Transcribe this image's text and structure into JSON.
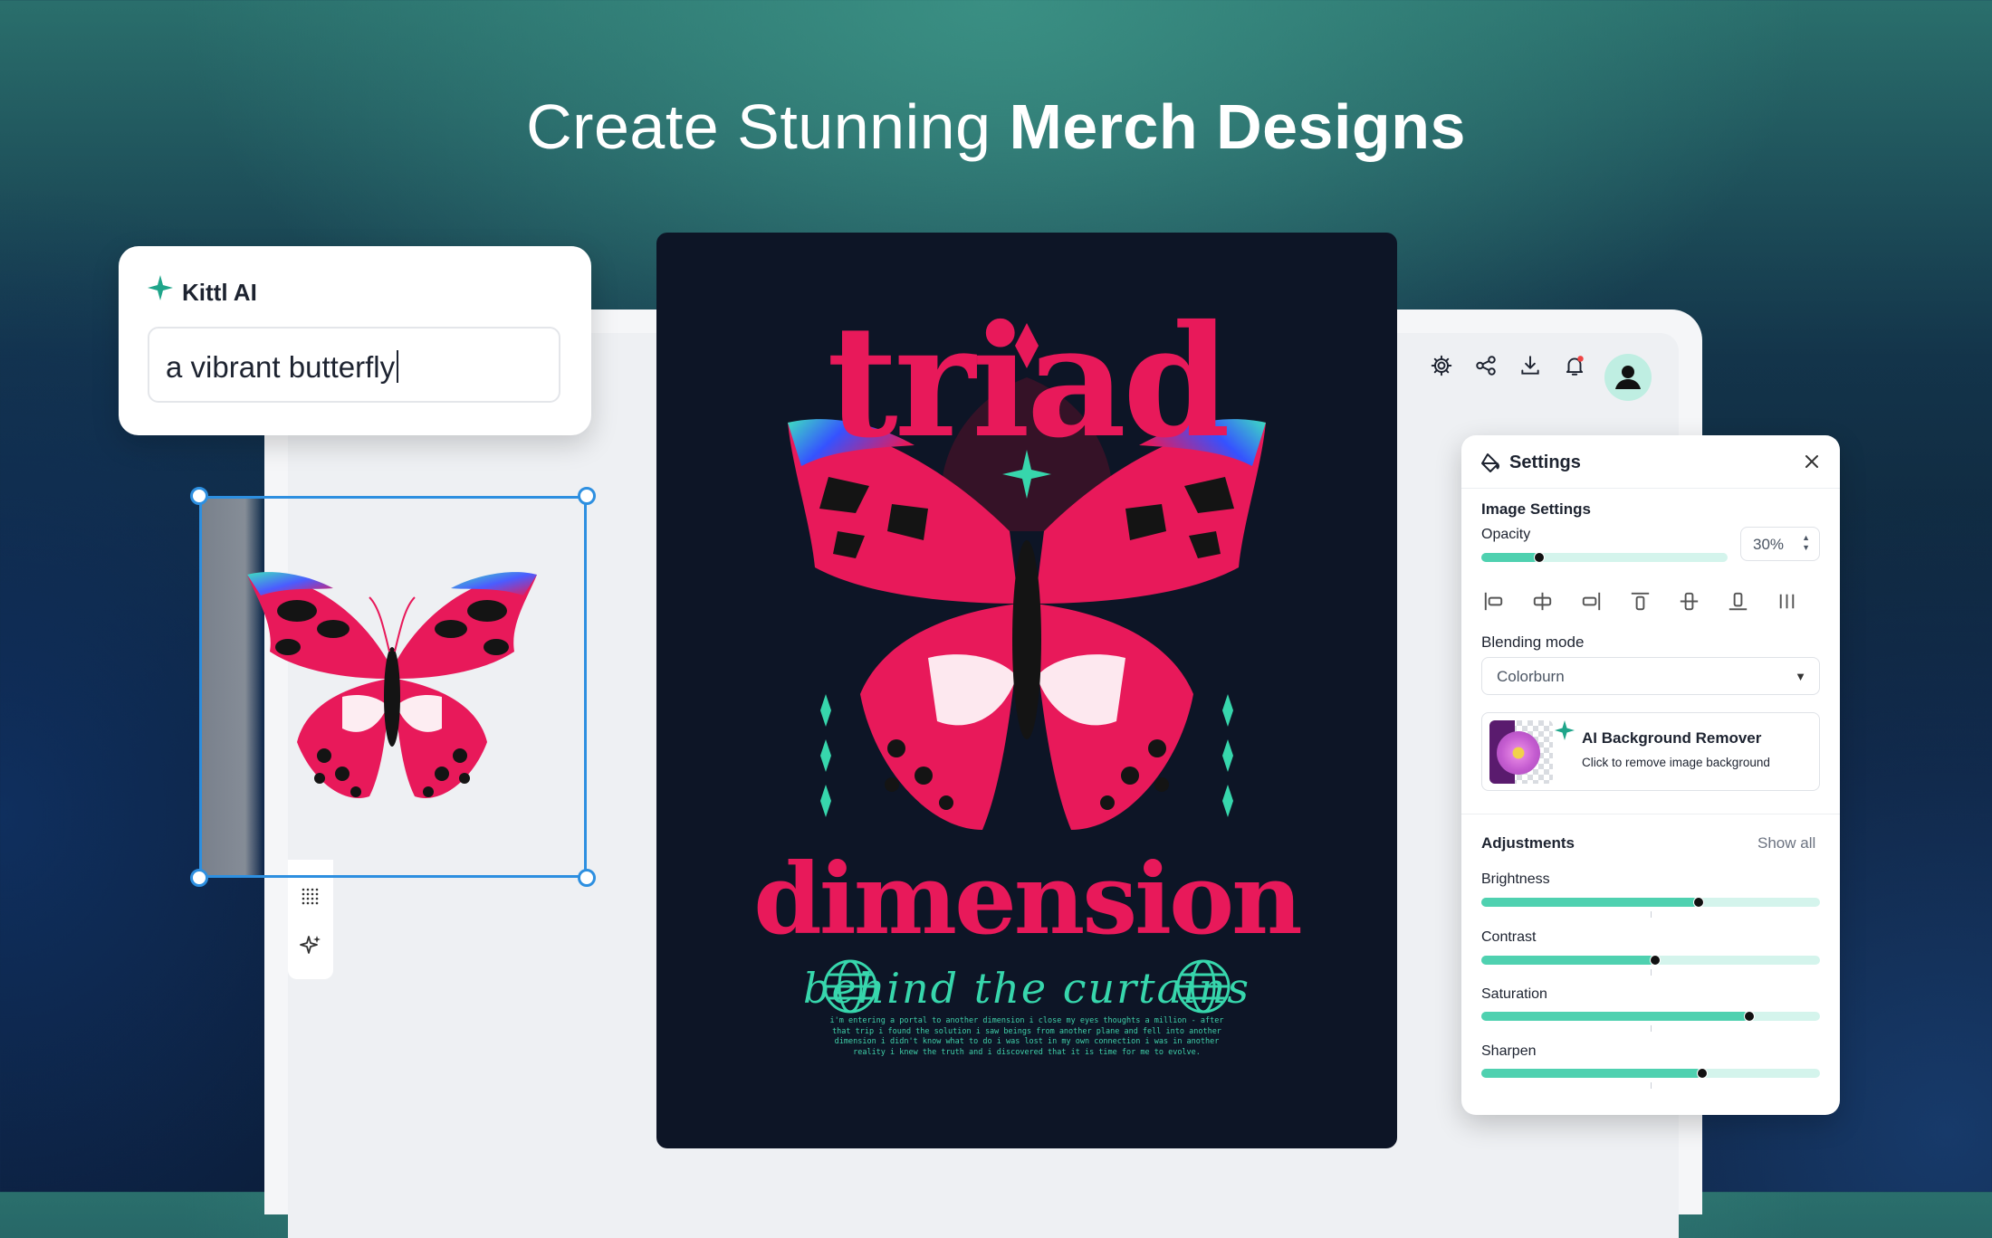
{
  "headline": {
    "light": "Create Stunning ",
    "bold": "Merch Designs"
  },
  "ai_prompt": {
    "title": "Kittl AI",
    "value": "a vibrant butterfly"
  },
  "poster": {
    "word1": "triad",
    "word2": "dimension",
    "tagline": "behind the curtains",
    "body": "i'm entering a portal to another dimension i close my eyes thoughts a million - after that trip i found the solution i saw beings from another plane and fell into another dimension i didn't know what to do i was lost in my own connection i was in another reality i knew the truth and i discovered that it is time for me to evolve."
  },
  "toolbar": {
    "icons": [
      "gear-icon",
      "share-icon",
      "download-icon",
      "bell-icon",
      "avatar-icon"
    ]
  },
  "settings": {
    "title": "Settings",
    "image_settings_label": "Image Settings",
    "opacity_label": "Opacity",
    "opacity_value": "30%",
    "opacity_level": 0.23,
    "blending_label": "Blending mode",
    "blending_value": "Colorburn",
    "ai_bg_title": "AI Background Remover",
    "ai_bg_sub": "Click to remove image background",
    "adjustments_label": "Adjustments",
    "show_all": "Show all",
    "sliders": [
      {
        "label": "Brightness",
        "level": 0.64
      },
      {
        "label": "Contrast",
        "level": 0.51
      },
      {
        "label": "Saturation",
        "level": 0.79
      },
      {
        "label": "Sharpen",
        "level": 0.65
      }
    ]
  },
  "colors": {
    "accent": "#4fd1b0",
    "poster_bg": "#0d1526",
    "poster_red": "#e8195a",
    "poster_teal": "#37d6ac",
    "selection": "#2d8fe0"
  }
}
